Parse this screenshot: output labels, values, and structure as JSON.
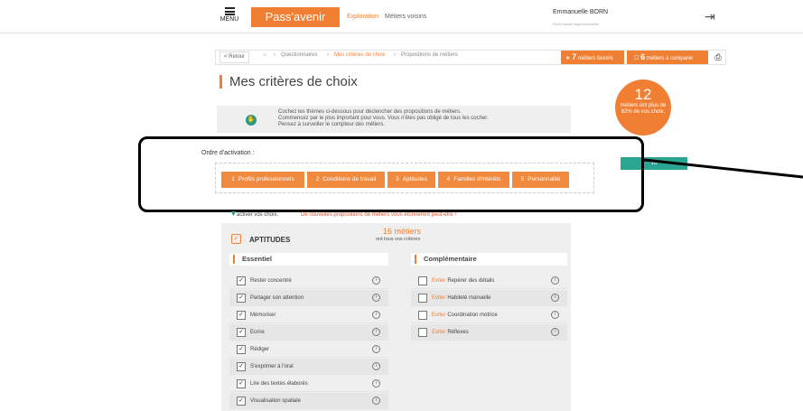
{
  "header": {
    "menu_label": "MENU",
    "brand": "Pass'avenir",
    "nav": [
      "Exploration",
      "Métiers voisins"
    ],
    "user_name": "Emmanuelle BORN",
    "user_sub": "Élève classe tapprocomaelie"
  },
  "breadcrumb": {
    "back": "< Retour",
    "items": [
      "Questionnaires",
      "Mes critères de choix",
      "Propositions de métiers"
    ],
    "favs_count": "7",
    "favs_label": "métiers favoris",
    "compare_count": "6",
    "compare_label": "métiers à comparer"
  },
  "page": {
    "title": "Mes critères de choix",
    "counter_num": "12",
    "counter_text": "métiers ont plus de 82% de vos choix.",
    "info_lines": [
      "Cochez les thèmes ci-dessous pour déclencher des propositions de métiers.",
      "Commencez par le plus important pour vous. Vous n'êtes pas obligé de tous les cocher.",
      "Pensez à surveiller le compteur des métiers."
    ],
    "ordre_label": "Ordre d'activation :",
    "steps": [
      {
        "n": "1",
        "label": "Profils professionnels"
      },
      {
        "n": "2",
        "label": "Conditions de travail"
      },
      {
        "n": "3",
        "label": "Aptitudes"
      },
      {
        "n": "4",
        "label": "Familles d'intérêts"
      },
      {
        "n": "5",
        "label": "Personnalité"
      }
    ],
    "voir_button": "Vo",
    "activate_text": "activer vos choix.",
    "warning_line2": "De nouvelles propositions de métiers vous étonneront peut-être !"
  },
  "aptitudes": {
    "label": "APTITUDES",
    "count": "16 métiers",
    "count_sub": "ont tous vos critères",
    "essentiel_header": "Essentiel",
    "complementaire_header": "Complémentaire",
    "essentiel": [
      "Rester concentré",
      "Partager son attention",
      "Mémoriser",
      "Ecrire",
      "Rédiger",
      "S'exprimer à l'oral",
      "Lire des textes élaborés",
      "Visualisation spatiale"
    ],
    "avoid_prefix": "Eviter",
    "complementaire": [
      "Repérer des détails",
      "Habileté manuelle",
      "Coordination motrice",
      "Réflexes"
    ]
  },
  "icons": {
    "logout": "logout-icon",
    "home": "home-icon",
    "star": "star-icon",
    "print": "printer-icon",
    "info": "info-icon"
  },
  "colors": {
    "accent": "#f07f33",
    "teal": "#2aa493"
  }
}
